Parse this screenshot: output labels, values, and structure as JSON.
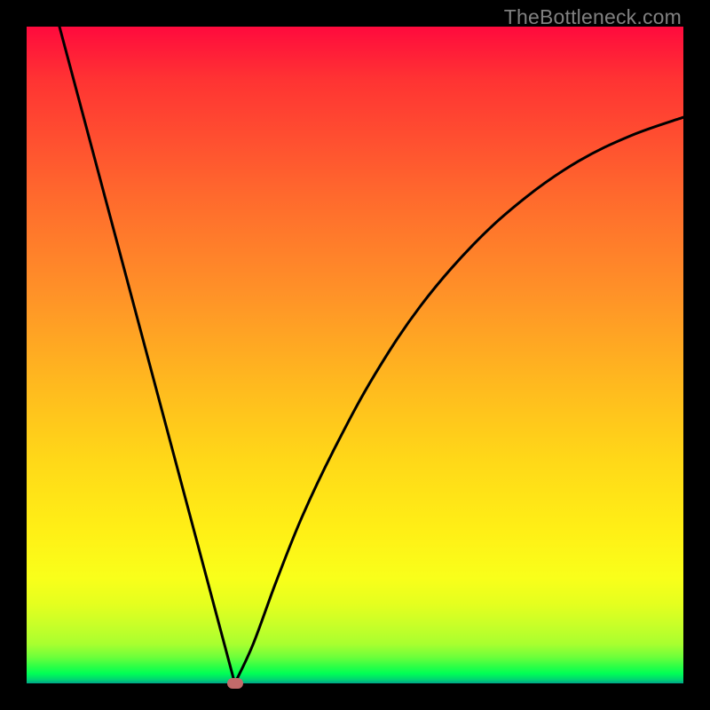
{
  "watermark": "TheBottleneck.com",
  "chart_data": {
    "type": "line",
    "title": "",
    "xlabel": "",
    "ylabel": "",
    "xlim": [
      0,
      1
    ],
    "ylim": [
      0,
      1
    ],
    "grid": false,
    "legend": false,
    "min_marker": {
      "x": 0.317,
      "y": 0.0
    },
    "series": [
      {
        "name": "bottleneck-curve",
        "color": "#000000",
        "points": [
          {
            "x": 0.05,
            "y": 1.0
          },
          {
            "x": 0.317,
            "y": 0.0
          },
          {
            "x": 0.345,
            "y": 0.06
          },
          {
            "x": 0.38,
            "y": 0.155
          },
          {
            "x": 0.42,
            "y": 0.255
          },
          {
            "x": 0.47,
            "y": 0.36
          },
          {
            "x": 0.53,
            "y": 0.47
          },
          {
            "x": 0.6,
            "y": 0.575
          },
          {
            "x": 0.68,
            "y": 0.668
          },
          {
            "x": 0.76,
            "y": 0.74
          },
          {
            "x": 0.84,
            "y": 0.795
          },
          {
            "x": 0.92,
            "y": 0.834
          },
          {
            "x": 1.0,
            "y": 0.862
          }
        ]
      }
    ]
  },
  "colors": {
    "curve": "#000000",
    "marker": "#c26a6a",
    "frame": "#000000",
    "watermark": "#808080"
  }
}
